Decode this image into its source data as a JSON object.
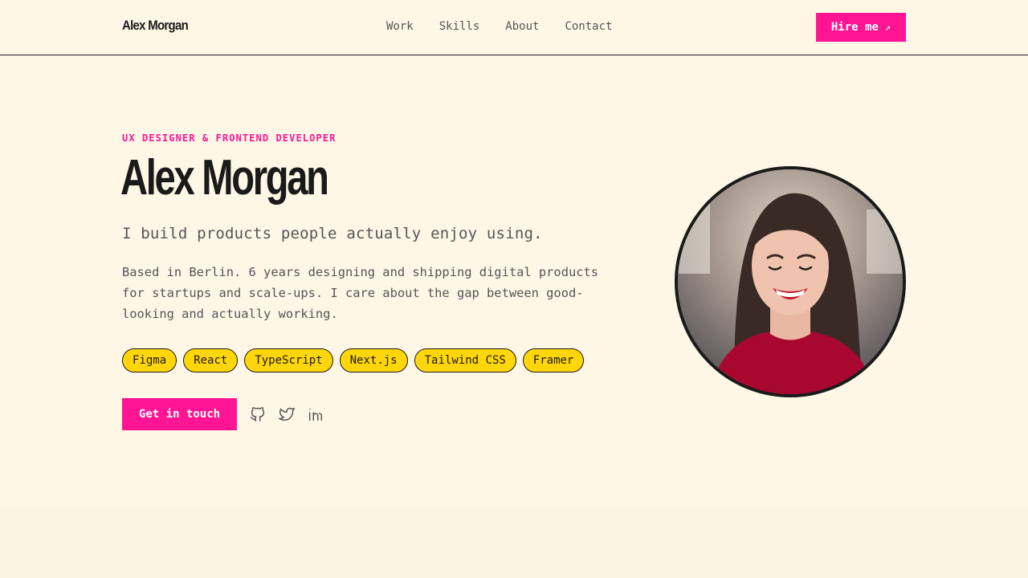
{
  "nav": {
    "brand": "Alex Morgan",
    "links": [
      "Work",
      "Skills",
      "About",
      "Contact"
    ],
    "hire_label": "Hire me",
    "hire_icon": "arrow-up-right-icon"
  },
  "hero": {
    "eyebrow": "UX DESIGNER & FRONTEND DEVELOPER",
    "title": "Alex Morgan",
    "subtitle": "I build products people actually enjoy using.",
    "bio": "Based in Berlin. 6 years designing and shipping digital products for startups and scale-ups. I care about the gap between good-looking and actually working.",
    "tags": [
      "Figma",
      "React",
      "TypeScript",
      "Next.js",
      "Tailwind CSS",
      "Framer"
    ],
    "cta_label": "Get in touch",
    "socials": [
      "github-icon",
      "twitter-icon",
      "linkedin-icon"
    ]
  },
  "colors": {
    "background": "#fef7e6",
    "accent": "#ff1493",
    "tag": "#ffd60a",
    "text": "#1a1a1a",
    "muted": "#555555"
  }
}
